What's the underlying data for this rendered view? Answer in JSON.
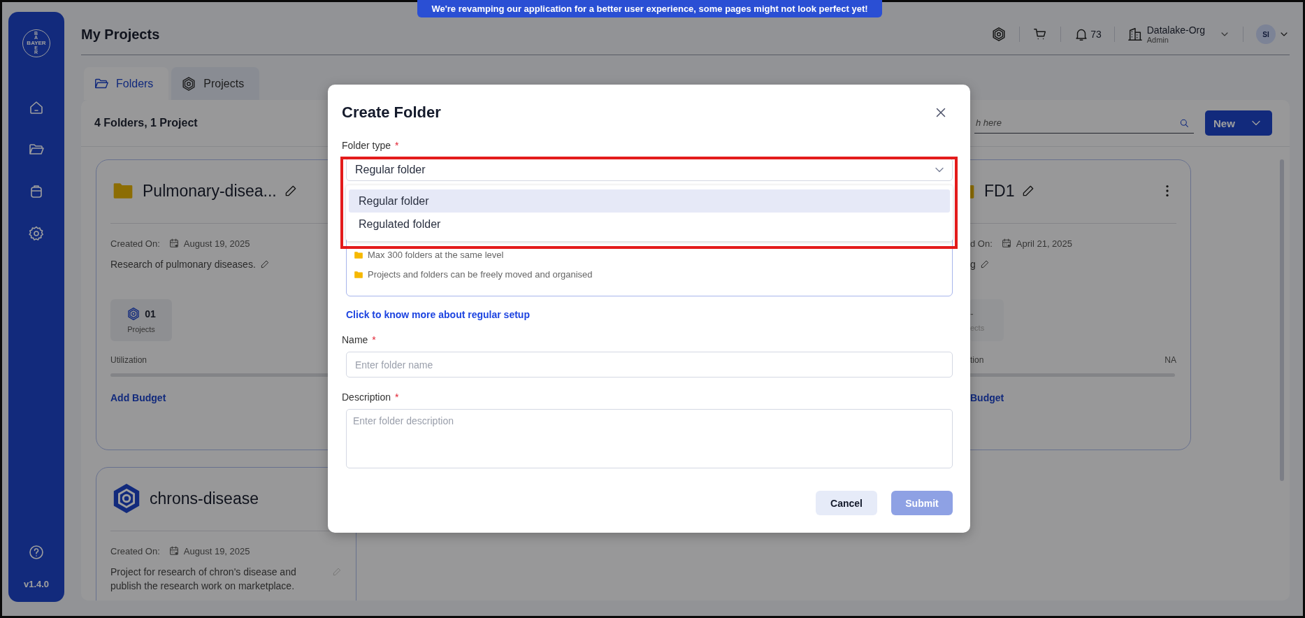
{
  "banner": {
    "text": "We're revamping our application for a better user experience, some pages might not look perfect yet!"
  },
  "sidebar": {
    "logo": {
      "horizontal": "BAYER",
      "vertical_top": [
        "B",
        "A"
      ],
      "vertical_bottom": [
        "E",
        "R"
      ]
    },
    "version": "v1.4.0"
  },
  "header": {
    "title": "My Projects",
    "notifications": "73",
    "org": {
      "name": "Datalake-Org",
      "role": "Admin"
    },
    "avatar": "SI"
  },
  "tabs": [
    {
      "label": "Folders",
      "selected": true
    },
    {
      "label": "Projects",
      "selected": false
    }
  ],
  "toolbar": {
    "summary": "4 Folders, 1 Project",
    "search": {
      "placeholder": "h here"
    },
    "new_button": "New"
  },
  "cards": [
    {
      "kind": "folder",
      "title": "Pulmonary-disea...",
      "created_label": "Created On:",
      "date": "August 19, 2025",
      "description": "Research of pulmonary diseases.",
      "stat": {
        "value": "01",
        "label": "Projects"
      },
      "utilization_label": "Utilization",
      "add_budget": "Add Budget"
    },
    {
      "kind": "folder",
      "title": "FD1",
      "created_label": "d On:",
      "date": "April 21, 2025",
      "description": "g",
      "stat": {
        "value": "-",
        "label": "ects"
      },
      "utilization_label": "tion",
      "utilization_value": "NA",
      "add_budget": "Budget"
    },
    {
      "kind": "project",
      "title": "chrons-disease",
      "created_label": "Created On:",
      "date": "August 19, 2025",
      "description": "Project for research of chron's disease and publish the research work on marketplace."
    }
  ],
  "dialog": {
    "title": "Create Folder",
    "folder_type": {
      "label": "Folder type",
      "required_mark": "*",
      "value": "Regular folder",
      "expanded": true,
      "options": [
        {
          "label": "Regular folder",
          "selected": true
        },
        {
          "label": "Regulated folder",
          "selected": false
        }
      ]
    },
    "info_items": [
      "Max 300 folders at the same level",
      "Projects and folders can be freely moved and organised"
    ],
    "link": "Click to know more about regular setup",
    "name": {
      "label": "Name",
      "required_mark": "*",
      "placeholder": "Enter folder name"
    },
    "description": {
      "label": "Description",
      "required_mark": "*",
      "placeholder": "Enter folder description"
    },
    "buttons": [
      {
        "kind": "secondary",
        "label": "Cancel",
        "disabled": false
      },
      {
        "kind": "primary",
        "label": "Submit",
        "disabled": true
      }
    ]
  }
}
